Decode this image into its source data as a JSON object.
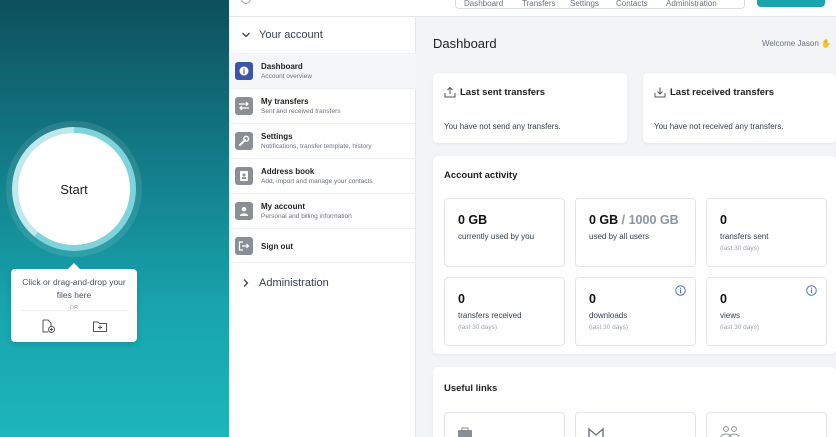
{
  "upload": {
    "start_label": "Start",
    "drop_text": "Click or drag-and-drop your files here",
    "or_label": "OR",
    "icons": [
      "add-file-icon",
      "add-folder-icon"
    ]
  },
  "topbar": {
    "nav": [
      "Dashboard",
      "Transfers",
      "Settings",
      "Contacts",
      "Administration"
    ]
  },
  "sidebar": {
    "account_section": "Your account",
    "items": [
      {
        "title": "Dashboard",
        "subtitle": "Account overview",
        "icon": "info-icon",
        "active": true
      },
      {
        "title": "My transfers",
        "subtitle": "Sent and received transfers",
        "icon": "transfer-arrows-icon"
      },
      {
        "title": "Settings",
        "subtitle": "Notifications, transfer template, history",
        "icon": "wrench-icon"
      },
      {
        "title": "Address book",
        "subtitle": "Add, import and manage your contacts",
        "icon": "address-book-icon"
      },
      {
        "title": "My account",
        "subtitle": "Personal and billing information",
        "icon": "user-icon"
      },
      {
        "title": "Sign out",
        "icon": "sign-out-icon"
      }
    ],
    "admin_section": "Administration"
  },
  "main": {
    "title": "Dashboard",
    "welcome": "Welcome Jason",
    "last_sent": {
      "title": "Last sent transfers",
      "text": "You have not send any transfers."
    },
    "last_received": {
      "title": "Last received transfers",
      "text": "You have not received any transfers."
    },
    "activity": {
      "title": "Account activity",
      "stats": [
        {
          "value": "0 GB",
          "label": "currently used by you"
        },
        {
          "value": "0 GB",
          "value_suffix": " / 1000 GB",
          "label": "used by all users"
        },
        {
          "value": "0",
          "label": "transfers sent",
          "sublabel": "(last 30 days)"
        },
        {
          "value": "0",
          "label": "transfers received",
          "sublabel": "(last 30 days)"
        },
        {
          "value": "0",
          "label": "downloads",
          "sublabel": "(last 30 days)",
          "info": true
        },
        {
          "value": "0",
          "label": "views",
          "sublabel": "(last 30 days)",
          "info": true
        }
      ]
    },
    "useful_links": {
      "title": "Useful links"
    }
  },
  "colors": {
    "accent": "#1aa4ad",
    "active_icon": "#3d55a8",
    "info_icon": "#4a6fc3"
  }
}
